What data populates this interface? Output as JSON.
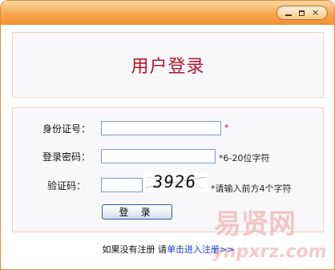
{
  "window": {
    "controls": {
      "minimize": "minimize",
      "maximize": "maximize",
      "close": "×"
    }
  },
  "header": {
    "title": "用户登录"
  },
  "form": {
    "id_label": "身份证号：",
    "id_value": "",
    "id_required": "*",
    "password_label": "登录密码：",
    "password_value": "",
    "password_hint": "*6-20位字符",
    "captcha_label": "验证码：",
    "captcha_value": "",
    "captcha_text": "3926",
    "captcha_hint": "*请输入前方4个字符",
    "submit_label": "登 录"
  },
  "footer": {
    "prefix": "如果没有注册 请",
    "link": "单击进入注册>>"
  },
  "watermark": {
    "main": "易贤网",
    "sub": "www.ynpxrz.com"
  },
  "colors": {
    "title": "#b3142a",
    "titlebar": "#f29035",
    "link": "#1a3cc8",
    "border": "#e08a3a"
  }
}
